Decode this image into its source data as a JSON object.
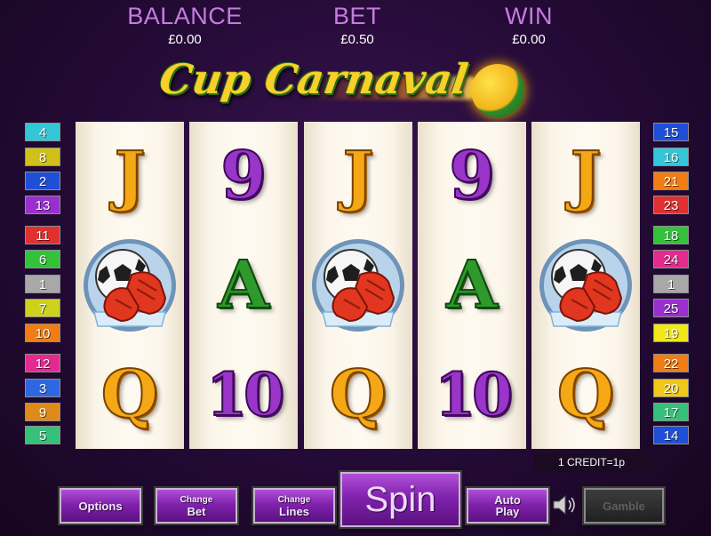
{
  "header": {
    "balance_label": "BALANCE",
    "balance_value": "£0.00",
    "bet_label": "BET",
    "bet_value": "£0.50",
    "win_label": "WIN",
    "win_value": "£0.00"
  },
  "logo": {
    "title": "Cup Carnaval"
  },
  "reels": [
    [
      "J",
      "football-gloves",
      "Q"
    ],
    [
      "9",
      "A",
      "10"
    ],
    [
      "J",
      "football-gloves",
      "Q"
    ],
    [
      "9",
      "A",
      "10"
    ],
    [
      "J",
      "football-gloves",
      "Q"
    ]
  ],
  "paylines_left": [
    "4",
    "8",
    "2",
    "13",
    "11",
    "6",
    "1",
    "7",
    "10",
    "12",
    "3",
    "9",
    "5"
  ],
  "paylines_right": [
    "15",
    "16",
    "21",
    "23",
    "18",
    "24",
    "1",
    "25",
    "19",
    "22",
    "20",
    "17",
    "14"
  ],
  "colors": {
    "left": [
      "#33c6d6",
      "#d1c019",
      "#1f4fd8",
      "#9a2fcf",
      "#e03030",
      "#33c23a",
      "#a8a8a8",
      "#cdd21e",
      "#f07d16",
      "#e42a8f",
      "#2f67e0",
      "#e08a1c",
      "#37c07a"
    ],
    "right": [
      "#1f4fd8",
      "#33c6d6",
      "#f07d16",
      "#e03030",
      "#33c23a",
      "#e42a8f",
      "#a8a8a8",
      "#9a2fcf",
      "#f0e81a",
      "#f07d16",
      "#f0c81a",
      "#37c07a",
      "#1f4fd8"
    ]
  },
  "credit_info": "1 CREDIT=1p",
  "buttons": {
    "options": "Options",
    "change_bet_top": "Change",
    "change_bet_bottom": "Bet",
    "change_lines_top": "Change",
    "change_lines_bottom": "Lines",
    "spin": "Spin",
    "auto_play_top": "Auto",
    "auto_play_bottom": "Play",
    "gamble": "Gamble"
  },
  "icons": {
    "sound": "speaker-icon",
    "ball": "football-icon"
  }
}
